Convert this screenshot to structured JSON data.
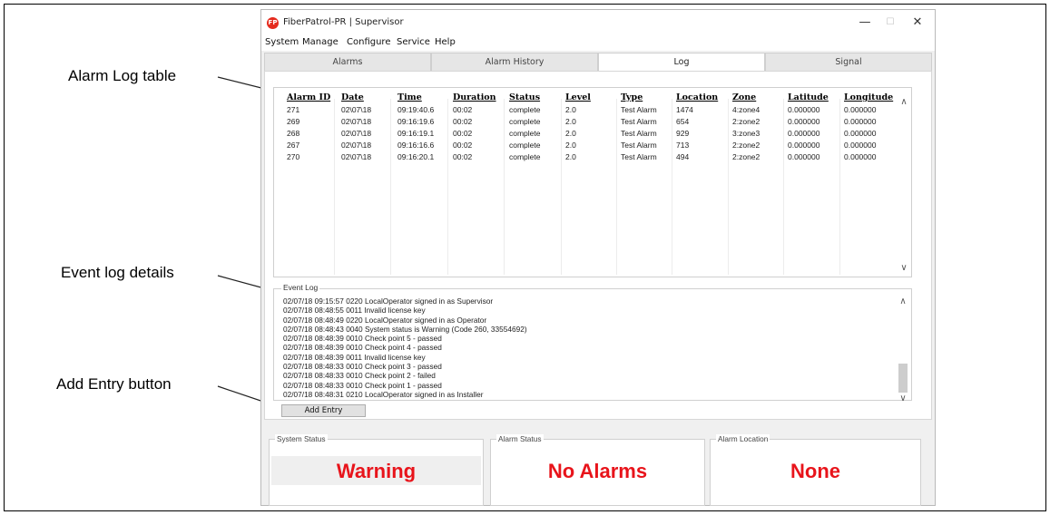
{
  "annotations": {
    "alarm_log": "Alarm Log table",
    "event_log": "Event log details",
    "add_entry": "Add Entry button"
  },
  "window": {
    "title": "FiberPatrol-PR | Supervisor",
    "minimize_glyph": "—",
    "maximize_glyph": "☐",
    "close_glyph": "✕"
  },
  "menu": [
    "System",
    "Manage",
    "Configure",
    "Service",
    "Help"
  ],
  "tabs": [
    "Alarms",
    "Alarm History",
    "Log",
    "Signal"
  ],
  "active_tab": "Log",
  "alarm_table": {
    "headers": [
      "Alarm ID",
      "Date",
      "Time",
      "Duration",
      "Status",
      "Level",
      "Type",
      "Location",
      "Zone",
      "Latitude",
      "Longitude"
    ],
    "rows": [
      [
        "271",
        "02\\07\\18",
        "09:19:40.6",
        "00:02",
        "complete",
        "2.0",
        "Test Alarm",
        "1474",
        "4:zone4",
        "0.000000",
        "0.000000"
      ],
      [
        "269",
        "02\\07\\18",
        "09:16:19.6",
        "00:02",
        "complete",
        "2.0",
        "Test Alarm",
        "654",
        "2:zone2",
        "0.000000",
        "0.000000"
      ],
      [
        "268",
        "02\\07\\18",
        "09:16:19.1",
        "00:02",
        "complete",
        "2.0",
        "Test Alarm",
        "929",
        "3:zone3",
        "0.000000",
        "0.000000"
      ],
      [
        "267",
        "02\\07\\18",
        "09:16:16.6",
        "00:02",
        "complete",
        "2.0",
        "Test Alarm",
        "713",
        "2:zone2",
        "0.000000",
        "0.000000"
      ],
      [
        "270",
        "02\\07\\18",
        "09:16:20.1",
        "00:02",
        "complete",
        "2.0",
        "Test Alarm",
        "494",
        "2:zone2",
        "0.000000",
        "0.000000"
      ]
    ]
  },
  "event_log": {
    "label": "Event Log",
    "lines": [
      "02/07/18 09:15:57 0220 LocalOperator signed in as Supervisor",
      "02/07/18 08:48:55 0011 Invalid license key",
      "02/07/18 08:48:49 0220 LocalOperator signed in as Operator",
      "02/07/18 08:48:43 0040 System status is Warning (Code 260, 33554692)",
      "02/07/18 08:48:39 0010 Check point 5 - passed",
      "02/07/18 08:48:39 0010 Check point 4 - passed",
      "02/07/18 08:48:39 0011 Invalid license key",
      "02/07/18 08:48:33 0010 Check point 3 - passed",
      "02/07/18 08:48:33 0010 Check point 2 - failed",
      "02/07/18 08:48:33 0010 Check point 1 - passed",
      "02/07/18 08:48:31 0210 LocalOperator signed in as Installer"
    ]
  },
  "add_entry_label": "Add Entry",
  "status": {
    "system": {
      "label": "System Status",
      "value": "Warning"
    },
    "alarm": {
      "label": "Alarm Status",
      "value": "No Alarms"
    },
    "location": {
      "label": "Alarm Location",
      "value": "None"
    }
  },
  "colors": {
    "status_red": "#e8141b",
    "icon_red": "#e52b1e"
  },
  "icons": {
    "app": "fiberpatrol-logo-icon",
    "scroll_up": "chevron-up-icon",
    "scroll_down": "chevron-down-icon"
  }
}
